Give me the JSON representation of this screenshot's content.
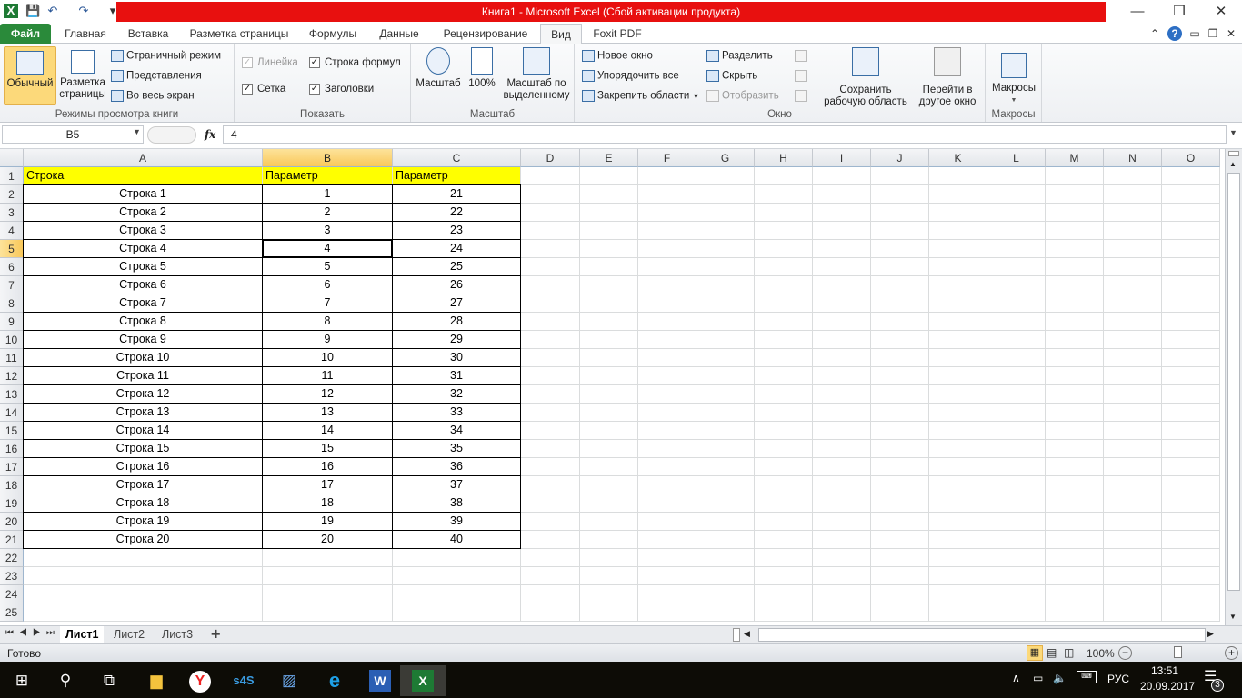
{
  "window": {
    "title": "Книга1  -  Microsoft Excel (Сбой активации продукта)"
  },
  "ribbon_tabs": [
    "Файл",
    "Главная",
    "Вставка",
    "Разметка страницы",
    "Формулы",
    "Данные",
    "Рецензирование",
    "Вид",
    "Foxit PDF"
  ],
  "active_tab": "Вид",
  "groups": {
    "views": {
      "label": "Режимы просмотра книги",
      "normal": "Обычный",
      "page_layout_1": "Разметка",
      "page_layout_2": "страницы",
      "page_break": "Страничный режим",
      "custom_views": "Представления",
      "full_screen": "Во весь экран"
    },
    "show": {
      "label": "Показать",
      "ruler": "Линейка",
      "formula_bar": "Строка формул",
      "gridlines": "Сетка",
      "headings": "Заголовки",
      "ruler_checked": true,
      "ruler_disabled": true,
      "formula_bar_checked": true,
      "gridlines_checked": true,
      "headings_checked": true
    },
    "zoom": {
      "label": "Масштаб",
      "zoom": "Масштаб",
      "hundred": "100%",
      "zoom_sel_1": "Масштаб по",
      "zoom_sel_2": "выделенному"
    },
    "window": {
      "label": "Окно",
      "new_window": "Новое окно",
      "arrange_all": "Упорядочить все",
      "freeze": "Закрепить области",
      "split": "Разделить",
      "hide": "Скрыть",
      "unhide": "Отобразить",
      "save_ws_1": "Сохранить",
      "save_ws_2": "рабочую область",
      "switch_1": "Перейти в",
      "switch_2": "другое окно"
    },
    "macros": {
      "label": "Макросы",
      "macros": "Макросы"
    }
  },
  "formula_bar": {
    "name_box": "B5",
    "fx": "fx",
    "value": "4"
  },
  "columns": [
    "A",
    "B",
    "C",
    "D",
    "E",
    "F",
    "G",
    "H",
    "I",
    "J",
    "K",
    "L",
    "M",
    "N",
    "O"
  ],
  "selected_cell": "B5",
  "table": {
    "headers": [
      "Строка",
      "Параметр",
      "Параметр"
    ],
    "rows": [
      [
        "Строка 1",
        1,
        21
      ],
      [
        "Строка 2",
        2,
        22
      ],
      [
        "Строка 3",
        3,
        23
      ],
      [
        "Строка 4",
        4,
        24
      ],
      [
        "Строка 5",
        5,
        25
      ],
      [
        "Строка 6",
        6,
        26
      ],
      [
        "Строка 7",
        7,
        27
      ],
      [
        "Строка 8",
        8,
        28
      ],
      [
        "Строка 9",
        9,
        29
      ],
      [
        "Строка 10",
        10,
        30
      ],
      [
        "Строка 11",
        11,
        31
      ],
      [
        "Строка 12",
        12,
        32
      ],
      [
        "Строка 13",
        13,
        33
      ],
      [
        "Строка 14",
        14,
        34
      ],
      [
        "Строка 15",
        15,
        35
      ],
      [
        "Строка 16",
        16,
        36
      ],
      [
        "Строка 17",
        17,
        37
      ],
      [
        "Строка 18",
        18,
        38
      ],
      [
        "Строка 19",
        19,
        39
      ],
      [
        "Строка 20",
        20,
        40
      ]
    ]
  },
  "visible_rows": 25,
  "header_fill": "#ffff00",
  "sheets": [
    "Лист1",
    "Лист2",
    "Лист3"
  ],
  "active_sheet": "Лист1",
  "status": {
    "ready": "Готово",
    "zoom": "100%"
  },
  "taskbar": {
    "lang": "РУС",
    "time": "13:51",
    "date": "20.09.2017",
    "notifications": "3"
  }
}
